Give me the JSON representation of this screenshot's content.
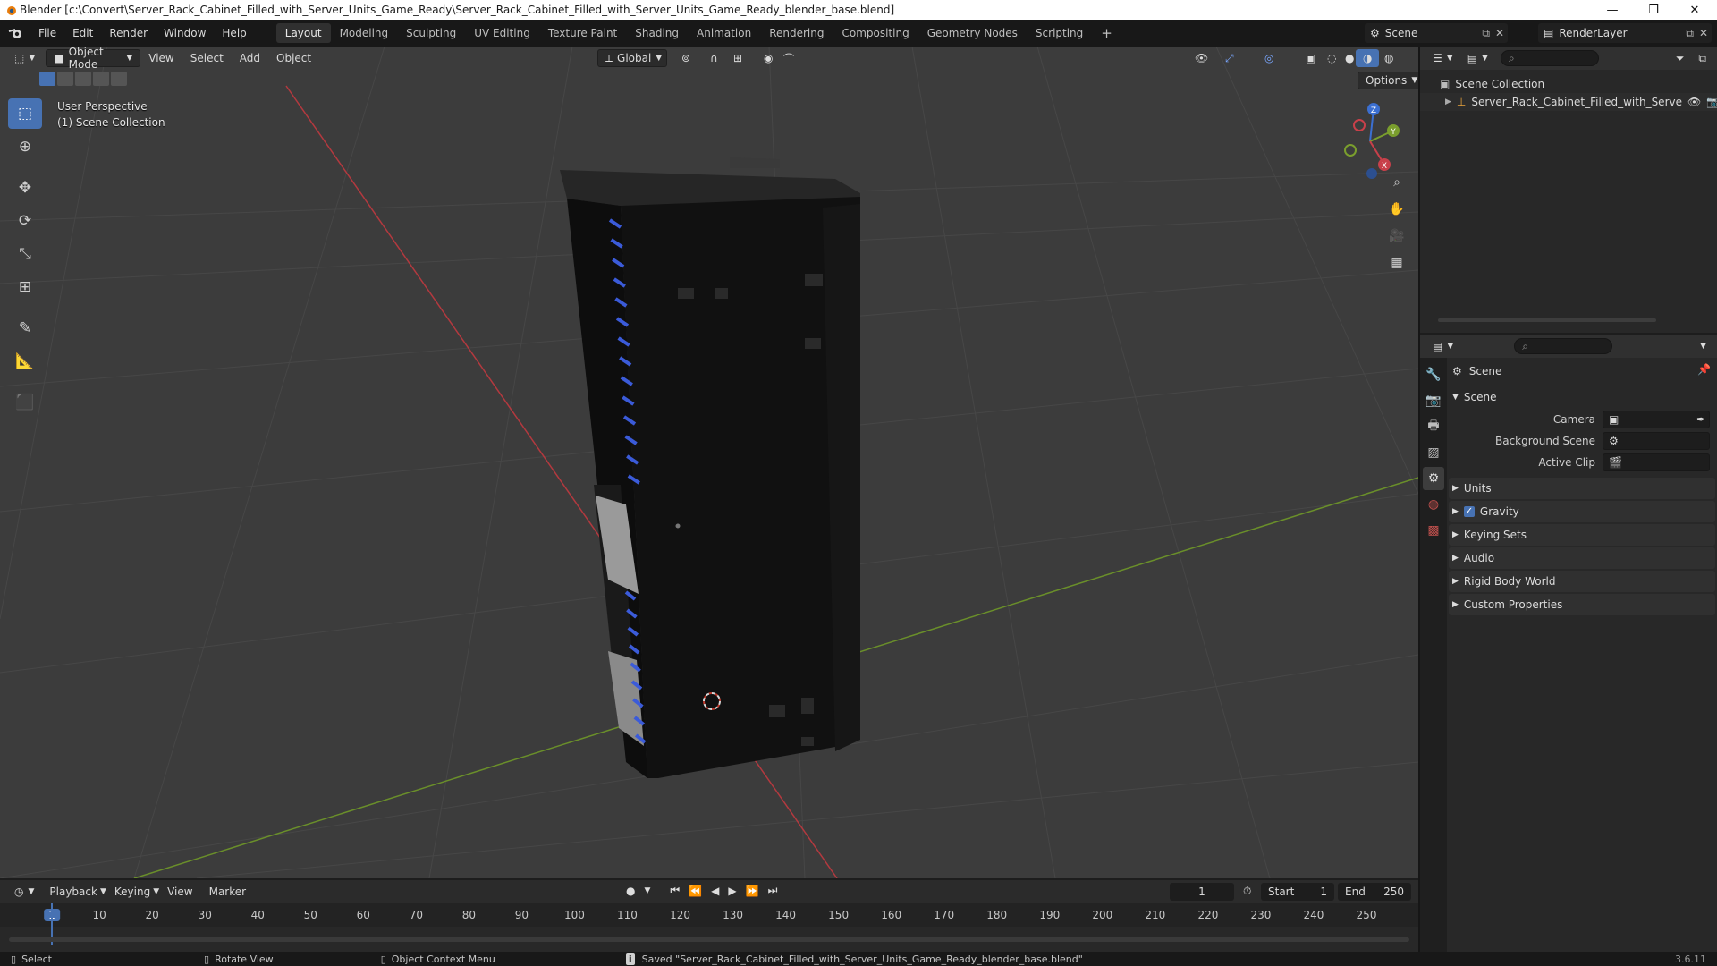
{
  "window": {
    "title": "Blender [c:\\Convert\\Server_Rack_Cabinet_Filled_with_Server_Units_Game_Ready\\Server_Rack_Cabinet_Filled_with_Server_Units_Game_Ready_blender_base.blend]",
    "minimize": "—",
    "maximize": "❐",
    "close": "✕"
  },
  "menu": {
    "items": [
      "File",
      "Edit",
      "Render",
      "Window",
      "Help"
    ]
  },
  "workspaces": {
    "tabs": [
      "Layout",
      "Modeling",
      "Sculpting",
      "UV Editing",
      "Texture Paint",
      "Shading",
      "Animation",
      "Rendering",
      "Compositing",
      "Geometry Nodes",
      "Scripting"
    ],
    "active": "Layout",
    "add": "+"
  },
  "topright": {
    "scene": "Scene",
    "view_layer": "RenderLayer"
  },
  "viewport": {
    "mode": "Object Mode",
    "menus": [
      "View",
      "Select",
      "Add",
      "Object"
    ],
    "transform_orientation": "Global",
    "options": "Options",
    "info_line1": "User Perspective",
    "info_line2": "(1) Scene Collection",
    "gizmo_axes": {
      "x": "X",
      "y": "Y",
      "z": "Z"
    },
    "colors": {
      "background": "#3c3c3c",
      "grid": "#474747",
      "x_axis": "#b3393f",
      "y_axis": "#6a8f2a",
      "accent": "#4772b3",
      "rack_led": "#3b5bd9"
    }
  },
  "tools": [
    "select-box",
    "cursor",
    "move",
    "rotate",
    "scale",
    "transform",
    "annotate",
    "measure",
    "add-cube"
  ],
  "outliner": {
    "root": "Scene Collection",
    "items": [
      {
        "name": "Server_Rack_Cabinet_Filled_with_Serve"
      }
    ]
  },
  "properties": {
    "context": "Scene",
    "section_scene": "Scene",
    "fields": [
      {
        "label": "Camera",
        "value": ""
      },
      {
        "label": "Background Scene",
        "value": ""
      },
      {
        "label": "Active Clip",
        "value": ""
      }
    ],
    "collapsed_sections": [
      "Units",
      "Gravity",
      "Keying Sets",
      "Audio",
      "Rigid Body World",
      "Custom Properties"
    ],
    "gravity_enabled": true
  },
  "timeline": {
    "menus": [
      "Playback",
      "Keying",
      "View",
      "Marker"
    ],
    "current_frame": "1",
    "start_label": "Start",
    "start": "1",
    "end_label": "End",
    "end": "250",
    "ticks": [
      "1",
      "10",
      "20",
      "30",
      "40",
      "50",
      "60",
      "70",
      "80",
      "90",
      "100",
      "110",
      "120",
      "130",
      "140",
      "150",
      "160",
      "170",
      "180",
      "190",
      "200",
      "210",
      "220",
      "230",
      "240",
      "250"
    ]
  },
  "statusbar": {
    "select": "Select",
    "rotate": "Rotate View",
    "context_menu": "Object Context Menu",
    "message": "Saved \"Server_Rack_Cabinet_Filled_with_Server_Units_Game_Ready_blender_base.blend\"",
    "version": "3.6.11"
  }
}
